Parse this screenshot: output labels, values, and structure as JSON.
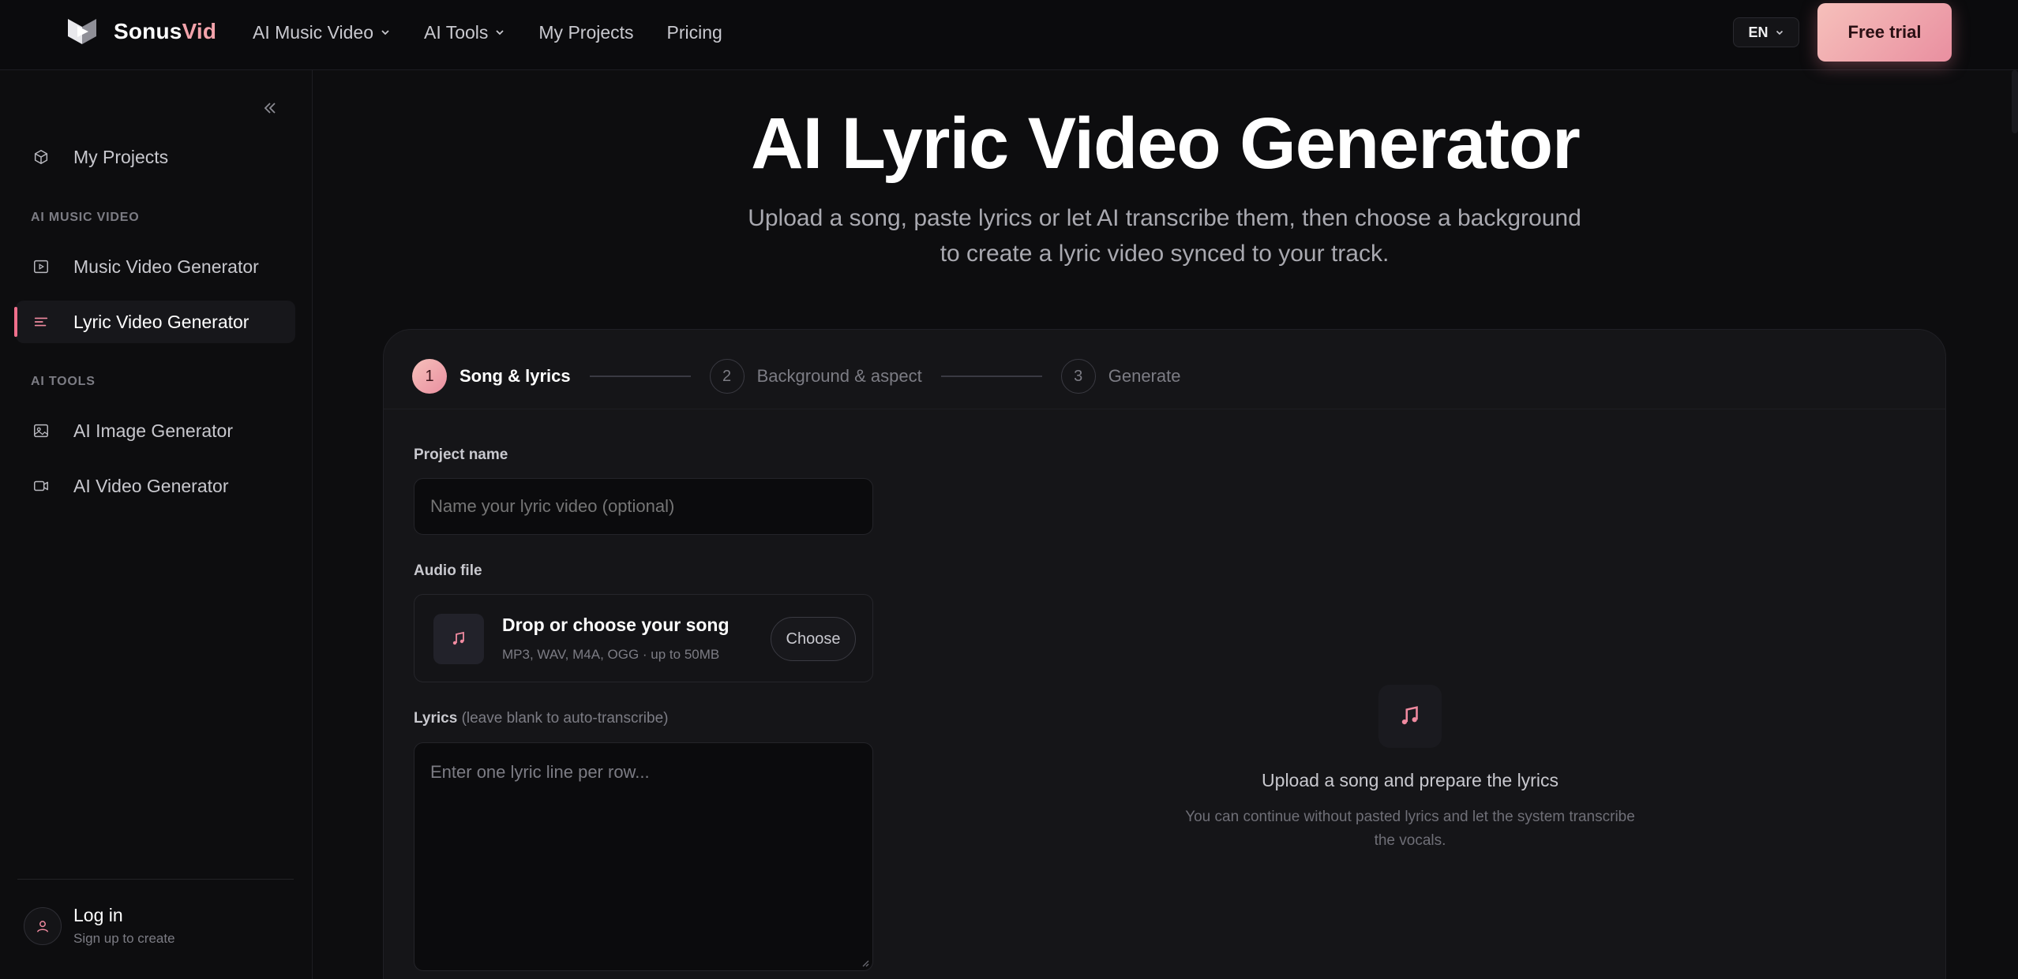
{
  "brand": {
    "name_part1": "Sonus",
    "name_part2": "Vid"
  },
  "nav": {
    "items": [
      {
        "label": "AI Music Video",
        "has_dropdown": true
      },
      {
        "label": "AI Tools",
        "has_dropdown": true
      },
      {
        "label": "My Projects",
        "has_dropdown": false
      },
      {
        "label": "Pricing",
        "has_dropdown": false
      }
    ],
    "language": "EN",
    "cta": "Free trial"
  },
  "sidebar": {
    "my_projects": "My Projects",
    "section_music": "AI MUSIC VIDEO",
    "music_video": "Music Video Generator",
    "lyric_video": "Lyric Video Generator",
    "section_tools": "AI TOOLS",
    "image_gen": "AI Image Generator",
    "video_gen": "AI Video Generator",
    "login_title": "Log in",
    "login_sub": "Sign up to create"
  },
  "hero": {
    "title": "AI Lyric Video Generator",
    "subtitle": "Upload a song, paste lyrics or let AI transcribe them, then choose a background to create a lyric video synced to your track."
  },
  "steps": [
    {
      "num": "1",
      "label": "Song & lyrics",
      "active": true
    },
    {
      "num": "2",
      "label": "Background & aspect",
      "active": false
    },
    {
      "num": "3",
      "label": "Generate",
      "active": false
    }
  ],
  "form": {
    "project_label": "Project name",
    "project_placeholder": "Name your lyric video (optional)",
    "audio_label": "Audio file",
    "upload_title": "Drop or choose your song",
    "upload_formats": "MP3, WAV, M4A, OGG · up to 50MB",
    "choose_button": "Choose",
    "lyrics_label": "Lyrics",
    "lyrics_hint": "(leave blank to auto-transcribe)",
    "lyrics_placeholder": "Enter one lyric line per row..."
  },
  "empty_state": {
    "title": "Upload a song and prepare the lyrics",
    "description": "You can continue without pasted lyrics and let the system transcribe the vocals."
  },
  "colors": {
    "accent": "#f08aa0",
    "cta_from": "#f6c0bb",
    "cta_to": "#e98fa0",
    "background": "#0d0d0f"
  }
}
